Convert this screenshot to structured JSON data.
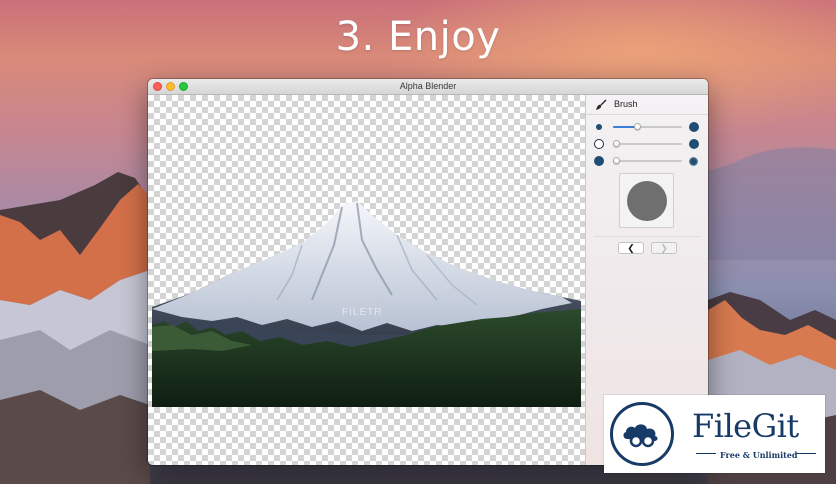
{
  "headline": "3. Enjoy",
  "window": {
    "title": "Alpha Blender"
  },
  "canvas": {
    "watermark": "FILETR"
  },
  "panel": {
    "title": "Brush",
    "icon": "brush-icon",
    "sliders": [
      {
        "name": "brush-size",
        "value": 0.35,
        "min_icon": "small-dot-icon",
        "max_icon": "large-dot-icon"
      },
      {
        "name": "brush-opacity",
        "value": 0.05,
        "min_icon": "hollow-circle-icon",
        "max_icon": "filled-circle-icon"
      },
      {
        "name": "brush-hardness",
        "value": 0.05,
        "min_icon": "hard-circle-icon",
        "max_icon": "soft-circle-icon"
      }
    ],
    "prev_label": "❮",
    "next_label": "❯"
  },
  "badge": {
    "name": "FileGit",
    "tagline": "Free & Unlimited"
  },
  "colors": {
    "accent": "#3d7bdc",
    "slider_dot": "#1f4d74",
    "badge": "#173b66"
  }
}
